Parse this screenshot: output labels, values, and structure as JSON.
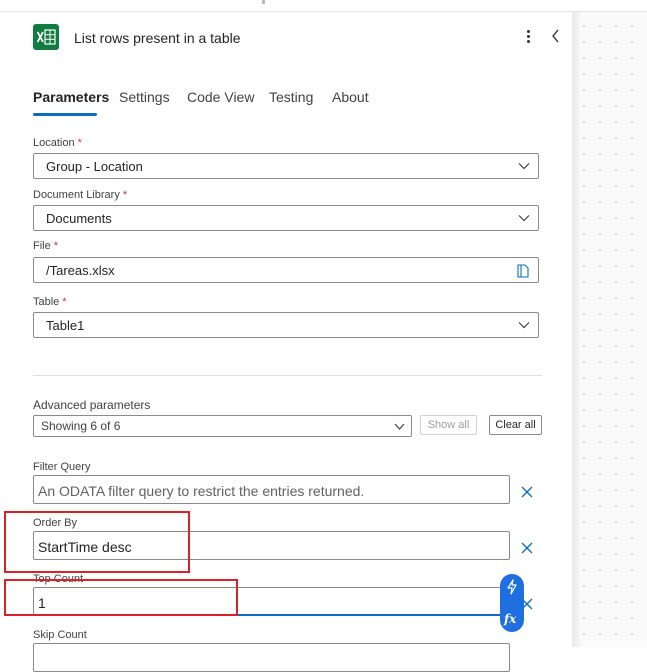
{
  "header": {
    "title": "List rows present in a table",
    "icon": "excel-icon",
    "brand_color": "#107c41"
  },
  "tabs": [
    {
      "label": "Parameters",
      "active": true
    },
    {
      "label": "Settings"
    },
    {
      "label": "Code View"
    },
    {
      "label": "Testing"
    },
    {
      "label": "About"
    }
  ],
  "fields": {
    "location": {
      "label": "Location",
      "required": "*",
      "value": "Group - Location"
    },
    "document_library": {
      "label": "Document Library",
      "required": "*",
      "value": "Documents"
    },
    "file": {
      "label": "File",
      "required": "*",
      "value": "/Tareas.xlsx"
    },
    "table": {
      "label": "Table",
      "required": "*",
      "value": "Table1"
    }
  },
  "advanced": {
    "label": "Advanced parameters",
    "selected": "Showing 6 of 6",
    "show_all": "Show all",
    "clear_all": "Clear all"
  },
  "params": {
    "filter_query": {
      "label": "Filter Query",
      "placeholder": "An ODATA filter query to restrict the entries returned."
    },
    "order_by": {
      "label": "Order By",
      "value": "StartTime desc"
    },
    "top_count": {
      "label": "Top Count",
      "value": "1"
    },
    "skip_count": {
      "label": "Skip Count"
    }
  },
  "colors": {
    "accent": "#0f6cbd",
    "highlight": "#d9222a",
    "fx_button": "#1f6fe0"
  }
}
